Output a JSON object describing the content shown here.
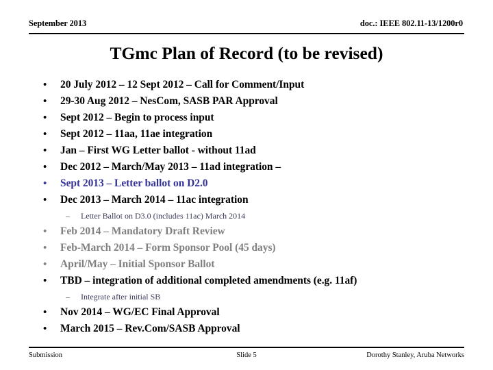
{
  "header": {
    "left": "September 2013",
    "right": "doc.: IEEE 802.11-13/1200r0"
  },
  "title": "TGmc Plan of Record (to be revised)",
  "colors": {
    "black": "#000000",
    "blue": "#333399",
    "gray": "#808080",
    "slate": "#3b3b5c"
  },
  "bullets": [
    {
      "level": 1,
      "marker": "•",
      "text": "20 July 2012 – 12 Sept 2012 – Call for Comment/Input",
      "color": "black"
    },
    {
      "level": 1,
      "marker": "•",
      "text": "29-30 Aug 2012 – NesCom, SASB PAR Approval",
      "color": "black"
    },
    {
      "level": 1,
      "marker": "•",
      "text": "Sept 2012 – Begin to process input",
      "color": "black"
    },
    {
      "level": 1,
      "marker": "•",
      "text": "Sept 2012 – 11aa, 11ae integration",
      "color": "black"
    },
    {
      "level": 1,
      "marker": "•",
      "text": "Jan – First WG Letter ballot  - without 11ad",
      "color": "black"
    },
    {
      "level": 1,
      "marker": "•",
      "text": "Dec 2012 – March/May 2013  – 11ad integration –",
      "color": "black"
    },
    {
      "level": 1,
      "marker": "•",
      "text": "Sept 2013 – Letter ballot on D2.0",
      "color": "blue"
    },
    {
      "level": 1,
      "marker": "•",
      "text": "Dec 2013 – March 2014 – 11ac integration",
      "color": "black"
    },
    {
      "level": 2,
      "marker": "–",
      "text": "Letter Ballot on D3.0 (includes 11ac) March 2014",
      "color": "slate"
    },
    {
      "level": 1,
      "marker": "•",
      "text": "Feb 2014 – Mandatory Draft Review",
      "color": "gray"
    },
    {
      "level": 1,
      "marker": "•",
      "text": "Feb-March 2014 – Form Sponsor Pool (45 days)",
      "color": "gray"
    },
    {
      "level": 1,
      "marker": "•",
      "text": "April/May – Initial Sponsor Ballot",
      "color": "gray"
    },
    {
      "level": 1,
      "marker": "•",
      "text": "TBD – integration of additional completed amendments (e.g. 11af)",
      "color": "black"
    },
    {
      "level": 2,
      "marker": "–",
      "text": "Integrate after initial SB",
      "color": "slate"
    },
    {
      "level": 1,
      "marker": "•",
      "text": "Nov 2014 – WG/EC Final Approval",
      "color": "black"
    },
    {
      "level": 1,
      "marker": "•",
      "text": "March 2015 – Rev.Com/SASB Approval",
      "color": "black"
    }
  ],
  "footer": {
    "left": "Submission",
    "center": "Slide 5",
    "right": "Dorothy Stanley, Aruba Networks"
  }
}
